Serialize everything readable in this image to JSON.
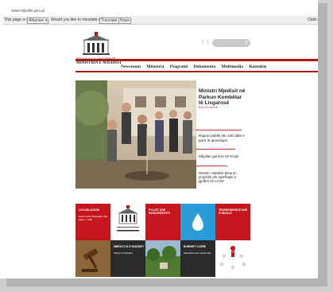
{
  "browser": {
    "address": "www.mjedisi.gov.al",
    "translate_prefix": "This page is in",
    "translate_lang": "Albanian ▾",
    "translate_question": "Would you like to translate it?",
    "translate_button": "Translate",
    "nope_button": "Nope",
    "options_label": "Optio"
  },
  "header": {
    "logo_line1": "REPUBLIKA E SHQIPËRISË",
    "logo_line2": "MINISTRIA E MJEDISIT",
    "social_f": "f",
    "social_t": "t",
    "search_icon": "search-icon"
  },
  "nav": [
    "Newsroom",
    "Ministria",
    "Programi",
    "Dokumenta",
    "Multimedia",
    "Kontakte"
  ],
  "feature": {
    "title": "Ministri Mjedisit në Parkun Kombëtar të Lixgarosë",
    "more": "lexo më shumë"
  },
  "side_news": [
    "Raport publik për 100 ditët e para të qeverisjes",
    "Mbyllen guroret në Krujë",
    "Ministri i Mjedisit përuron projektin për sipërfaqet e gjelbra në Lezhë"
  ],
  "tiles_row1": [
    {
      "title": "LEGJISLACIONI",
      "sub": "Dokumente Strategjike dhe ligjore, 1.905",
      "color": "#c5161d"
    },
    {
      "title": "",
      "sub": "",
      "color": "#ffffff"
    },
    {
      "title": "PYLLET DHE BIODIVERSITETI",
      "sub": "",
      "color": "#c5161d"
    },
    {
      "title": "",
      "sub": "",
      "color": "#2a9cd8"
    },
    {
      "title": "TRANSPARENCË DHE PUBLIKUT",
      "sub": "",
      "color": "#c5161d"
    }
  ],
  "tiles_row2": [
    {
      "title": "",
      "sub": "",
      "color": "#b38b4f"
    },
    {
      "title": "MBROJTJA E MJEDISIT",
      "sub": "Planet Kombëtare",
      "color": "#2b2b2b"
    },
    {
      "title": "",
      "sub": "",
      "color": "#5d8a3a"
    },
    {
      "title": "BURIMET UJORE",
      "sub": "Menaxhimi për Ujërat dhe",
      "color": "#2b2b2b"
    },
    {
      "title": "",
      "sub": "",
      "color": "#ffffff"
    }
  ],
  "colors": {
    "brand_red": "#b11a1a",
    "nav_text": "#222222"
  }
}
